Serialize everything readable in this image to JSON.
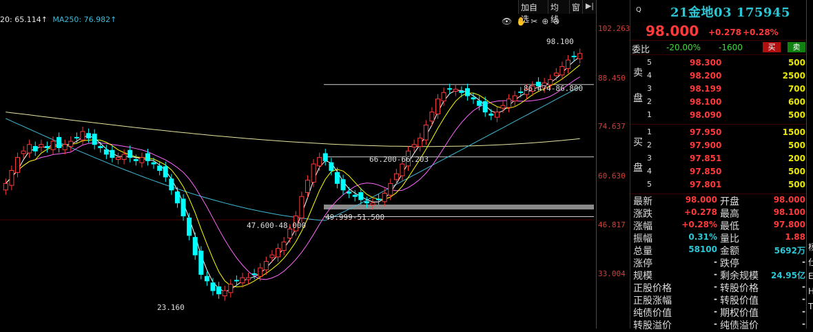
{
  "chart": {
    "ma_header": {
      "ma20": "20: 65.114↑",
      "ma250": "MA250: 76.982↑"
    },
    "toolbar": [
      "加自选",
      "均线",
      "窗"
    ],
    "toolbar_arrow": "▶|",
    "tool_icons": [
      {
        "glyph": "👁",
        "name": "eye-icon"
      },
      {
        "glyph": "✋",
        "name": "hand-icon"
      },
      {
        "glyph": "✂",
        "name": "scissors-icon"
      },
      {
        "glyph": "⊕",
        "name": "zoom-in-icon"
      },
      {
        "glyph": "⊖",
        "name": "zoom-out-icon"
      }
    ],
    "price_axis": [
      "102.263",
      "88.450",
      "74.637",
      "60.630",
      "46.817",
      "33.004"
    ],
    "annotations": {
      "high": "98.100",
      "low": "23.160",
      "range1": "86.474-86.800",
      "range2": "66.200-66.203",
      "range3": "49.999-51.500",
      "range4": "47.600-48.000"
    },
    "colors": {
      "up": "#ff3a3a",
      "down": "#00ffff",
      "ma5": "#ffffff",
      "ma10": "#ffff00",
      "ma20": "#ff66ff",
      "ma60": "#3fb9d6",
      "ma250": "#e6e6a0"
    }
  },
  "chart_data": {
    "type": "candlestick",
    "title": "",
    "y_ticks": [
      102.263,
      88.45,
      74.637,
      60.63,
      46.817,
      33.004
    ],
    "ylim": [
      18,
      106
    ],
    "close": [
      58,
      62,
      66,
      68,
      70,
      68,
      70,
      69,
      71,
      69,
      70,
      71,
      72,
      74,
      72,
      70,
      69,
      67,
      66,
      66,
      67,
      66,
      65,
      66,
      65,
      64,
      62,
      60,
      56,
      52,
      48,
      42,
      36,
      30,
      28,
      25,
      24,
      25,
      27,
      28,
      29,
      29,
      30,
      32,
      34,
      36,
      38,
      40,
      44,
      48,
      54,
      59,
      64,
      66,
      65,
      62,
      58,
      56,
      55,
      54,
      53,
      52,
      52,
      53,
      55,
      58,
      61,
      64,
      68,
      70,
      72,
      76,
      80,
      84,
      86,
      87,
      87,
      86,
      85,
      84,
      82,
      80,
      79,
      80,
      82,
      84,
      85,
      86,
      87,
      88,
      88,
      89,
      90,
      92,
      94,
      96,
      97,
      98
    ]
  },
  "side": {
    "q_label": "Q",
    "title": "21金地03 175945",
    "last": "98.000",
    "change": "+0.278",
    "change_pct": "+0.28%",
    "weibi_label": "委比",
    "weibi_ratio": "-20.00%",
    "weibi_diff": "-1600",
    "buy_btn": "买",
    "sell_btn": "卖",
    "sell_label": [
      "卖",
      "盘"
    ],
    "buy_label": [
      "买",
      "盘"
    ],
    "asks": [
      {
        "lvl": "5",
        "px": "98.300",
        "qty": "500"
      },
      {
        "lvl": "4",
        "px": "98.200",
        "qty": "2500"
      },
      {
        "lvl": "3",
        "px": "98.199",
        "qty": "700"
      },
      {
        "lvl": "2",
        "px": "98.100",
        "qty": "600"
      },
      {
        "lvl": "1",
        "px": "98.090",
        "qty": "500"
      }
    ],
    "bids": [
      {
        "lvl": "1",
        "px": "97.950",
        "qty": "1500"
      },
      {
        "lvl": "2",
        "px": "97.900",
        "qty": "500"
      },
      {
        "lvl": "3",
        "px": "97.851",
        "qty": "200"
      },
      {
        "lvl": "4",
        "px": "97.850",
        "qty": "500"
      },
      {
        "lvl": "5",
        "px": "97.801",
        "qty": "500"
      }
    ],
    "stats": [
      {
        "l1": "最新",
        "v1": "98.000",
        "c1": "red",
        "l2": "开盘",
        "v2": "98.000",
        "c2": "red"
      },
      {
        "l1": "涨跌",
        "v1": "+0.278",
        "c1": "red",
        "l2": "最高",
        "v2": "98.100",
        "c2": "red"
      },
      {
        "l1": "涨幅",
        "v1": "+0.28%",
        "c1": "red",
        "l2": "最低",
        "v2": "97.800",
        "c2": "red"
      },
      {
        "l1": "振幅",
        "v1": "0.31%",
        "c1": "cyan",
        "l2": "量比",
        "v2": "1.88",
        "c2": "red"
      },
      {
        "l1": "总量",
        "v1": "58100",
        "c1": "cyan",
        "l2": "金额",
        "v2": "5692万",
        "c2": "cyan"
      },
      {
        "l1": "涨停",
        "v1": "-",
        "c1": "white",
        "l2": "跌停",
        "v2": "-",
        "c2": "white"
      },
      {
        "l1": "规模",
        "v1": "-",
        "c1": "white",
        "l2": "剩余规模",
        "v2": "24.95亿",
        "c2": "cyan"
      },
      {
        "l1": "正股价格",
        "v1": "-",
        "c1": "white",
        "l2": "转股价格",
        "v2": "-",
        "c2": "white"
      },
      {
        "l1": "正股涨幅",
        "v1": "-",
        "c1": "white",
        "l2": "转股价值",
        "v2": "-",
        "c2": "white"
      },
      {
        "l1": "纯债价值",
        "v1": "-",
        "c1": "white",
        "l2": "期权价值",
        "v2": "-",
        "c2": "white"
      },
      {
        "l1": "转股溢价",
        "v1": "-",
        "c1": "white",
        "l2": "纯债溢价",
        "v2": "-",
        "c2": "white"
      }
    ],
    "edge": [
      "杨",
      "仕",
      "E",
      "H",
      "T"
    ]
  }
}
